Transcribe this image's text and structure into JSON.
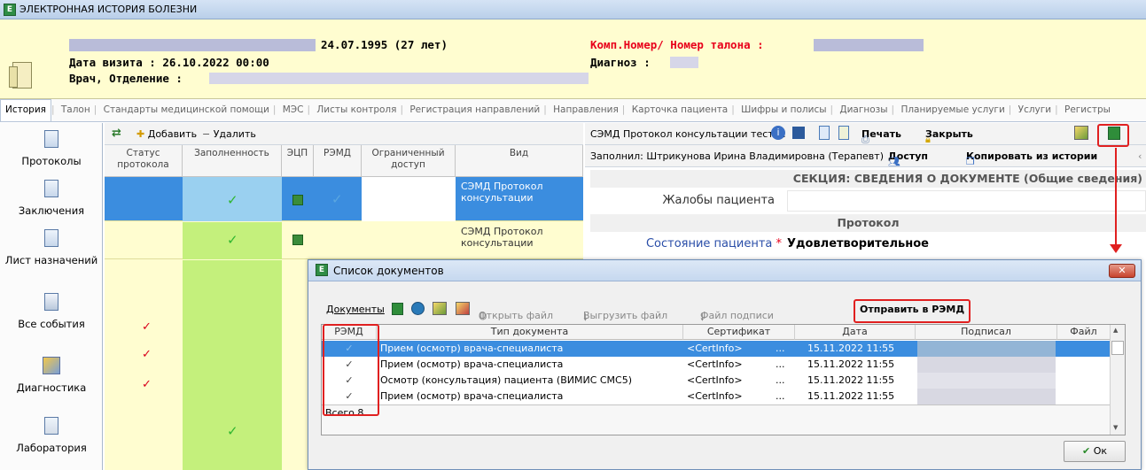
{
  "window": {
    "title": "ЭЛЕКТРОННАЯ ИСТОРИЯ БОЛЕЗНИ",
    "icon_letter": "Е"
  },
  "header": {
    "birth": "24.07.1995 (27 лет)",
    "visit_date": "Дата визита : 26.10.2022 00:00",
    "doctor": "Врач, Отделение :",
    "comp_number": "Комп.Номер/ Номер талона :",
    "diagnosis": "Диагноз :"
  },
  "tabs": [
    "История",
    "Талон",
    "Стандарты медицинской помощи",
    "МЭС",
    "Листы контроля",
    "Регистрация направлений",
    "Направления",
    "Карточка пациента",
    "Шифры и полисы",
    "Диагнозы",
    "Планируемые услуги",
    "Услуги",
    "Регистры"
  ],
  "sidebar": {
    "items": [
      "Протоколы",
      "Заключения",
      "Лист назначений",
      "Все события",
      "Диагностика",
      "Лаборатория"
    ]
  },
  "left_toolbar": {
    "add": "Добавить",
    "remove": "Удалить"
  },
  "grid": {
    "headers": [
      "Статус протокола",
      "Заполненность",
      "ЭЦП",
      "РЭМД",
      "Ограниченный доступ",
      "Вид"
    ],
    "rows": [
      {
        "kind": "СЭМД Протокол консультации"
      },
      {
        "kind": "СЭМД Протокол консультации"
      }
    ]
  },
  "right_toolbar": {
    "doc_title": "СЭМД Протокол консультации тест ...",
    "print": "Печать",
    "close": "Закрыть",
    "filled_by": "Заполнил: Штрикунова Ирина Владимировна (Терапевт)",
    "access": "Доступ",
    "copy_from_history": "Копировать из истории"
  },
  "form": {
    "section": "СЕКЦИЯ: СВЕДЕНИЯ О ДОКУМЕНТЕ (Общие сведения)",
    "complaints_label": "Жалобы пациента",
    "protocol_header": "Протокол",
    "state_label": "Состояние пациента",
    "required_mark": "*",
    "state_value": "Удовлетворительное"
  },
  "dialog": {
    "title": "Список документов",
    "icon_letter": "Е",
    "toolbar": {
      "docs": "Документы",
      "open_file": "Открыть файл",
      "export_file": "Выгрузить файл",
      "sign_file": "Файл подписи",
      "send": "Отправить в РЭМД"
    },
    "columns": [
      "РЭМД",
      "Тип документа",
      "Сертификат",
      "Дата",
      "Подписал",
      "Файл"
    ],
    "rows": [
      {
        "remd": "✓",
        "type": "Прием (осмотр) врача-специалиста",
        "cert": "<CertInfo>",
        "ellipsis": "...",
        "date": "15.11.2022 11:55"
      },
      {
        "remd": "✓",
        "type": "Прием (осмотр) врача-специалиста",
        "cert": "<CertInfo>",
        "ellipsis": "...",
        "date": "15.11.2022 11:55"
      },
      {
        "remd": "✓",
        "type": "Осмотр (консультация) пациента (ВИМИС СМС5)",
        "cert": "<CertInfo>",
        "ellipsis": "...",
        "date": "15.11.2022 11:55"
      },
      {
        "remd": "✓",
        "type": "Прием (осмотр) врача-специалиста",
        "cert": "<CertInfo>",
        "ellipsis": "...",
        "date": "15.11.2022 11:55"
      }
    ],
    "footer": "Всего 8",
    "ok": "Ок"
  },
  "colors": {
    "selection": "#3b8ddf",
    "highlight": "#e02020",
    "header_bg": "#fffdd0",
    "grid_bg": "#fffdd0",
    "accent_red": "#e8001b"
  }
}
